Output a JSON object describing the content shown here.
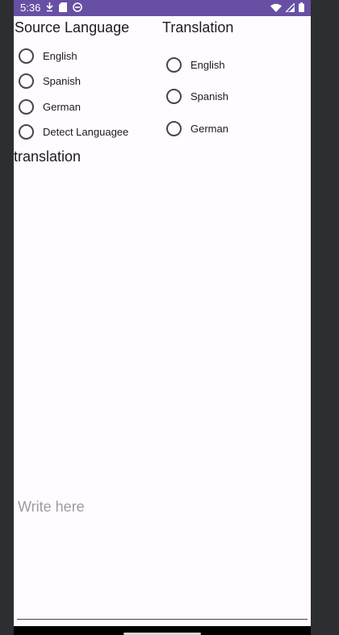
{
  "status_bar": {
    "time": "5:36",
    "left_icons": [
      "download-icon",
      "sd-card-icon",
      "circle-app-icon"
    ],
    "right_icons": [
      "wifi-icon",
      "signal-icon",
      "battery-icon"
    ],
    "color": "#6750a4"
  },
  "source_section": {
    "title": "Source Language",
    "options": [
      "English",
      "Spanish",
      "German",
      "Detect Languagee"
    ]
  },
  "target_section": {
    "title": "Translation",
    "options": [
      "English",
      "Spanish",
      "German"
    ]
  },
  "output": {
    "label": "translation"
  },
  "input": {
    "placeholder": "Write here"
  }
}
